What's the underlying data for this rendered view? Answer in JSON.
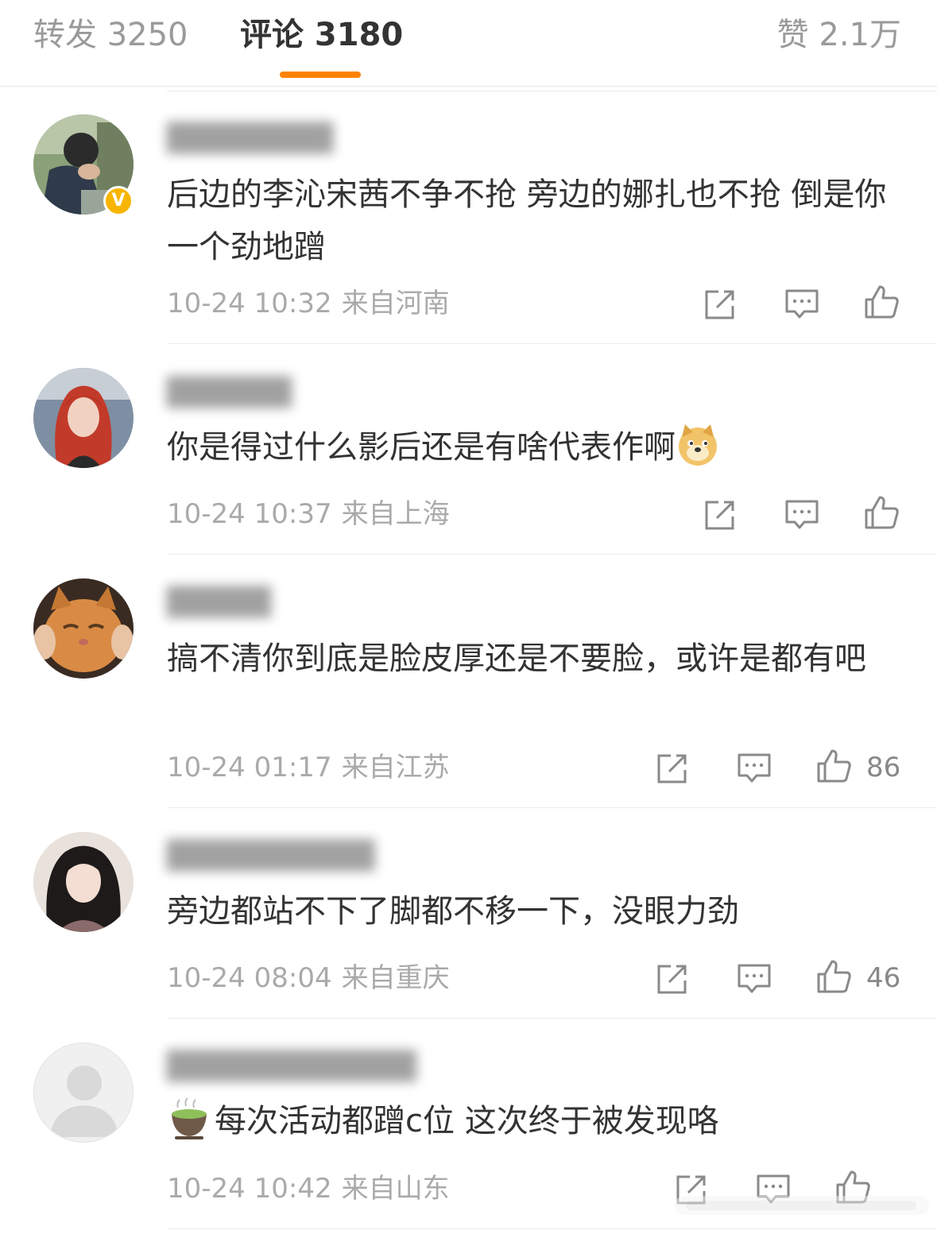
{
  "tabs": {
    "repost": "转发 3250",
    "comments": "评论 3180",
    "likes": "赞 2.1万"
  },
  "comments": [
    {
      "text": "后边的李沁宋茜不争不抢 旁边的娜扎也不抢 倒是你一个劲地蹭",
      "time": "10-24 10:32",
      "location": "来自河南",
      "like_count": "",
      "verified": true
    },
    {
      "text": "你是得过什么影后还是有啥代表作啊",
      "time": "10-24 10:37",
      "location": "来自上海",
      "like_count": "",
      "emoji_after": "doge-icon"
    },
    {
      "text": "搞不清你到底是脸皮厚还是不要脸，或许是都有吧",
      "time": "10-24 01:17",
      "location": "来自江苏",
      "like_count": "86"
    },
    {
      "text": "旁边都站不下了脚都不移一下，没眼力劲",
      "time": "10-24 08:04",
      "location": "来自重庆",
      "like_count": "46"
    },
    {
      "text": "每次活动都蹭c位 这次终于被发现咯",
      "time": "10-24 10:42",
      "location": "来自山东",
      "like_count": "",
      "emoji_before": "green-tea-icon"
    }
  ],
  "colors": {
    "accent": "#ff8200",
    "text": "#333333",
    "meta": "#aaaaaa",
    "verified": "#f7b500"
  }
}
